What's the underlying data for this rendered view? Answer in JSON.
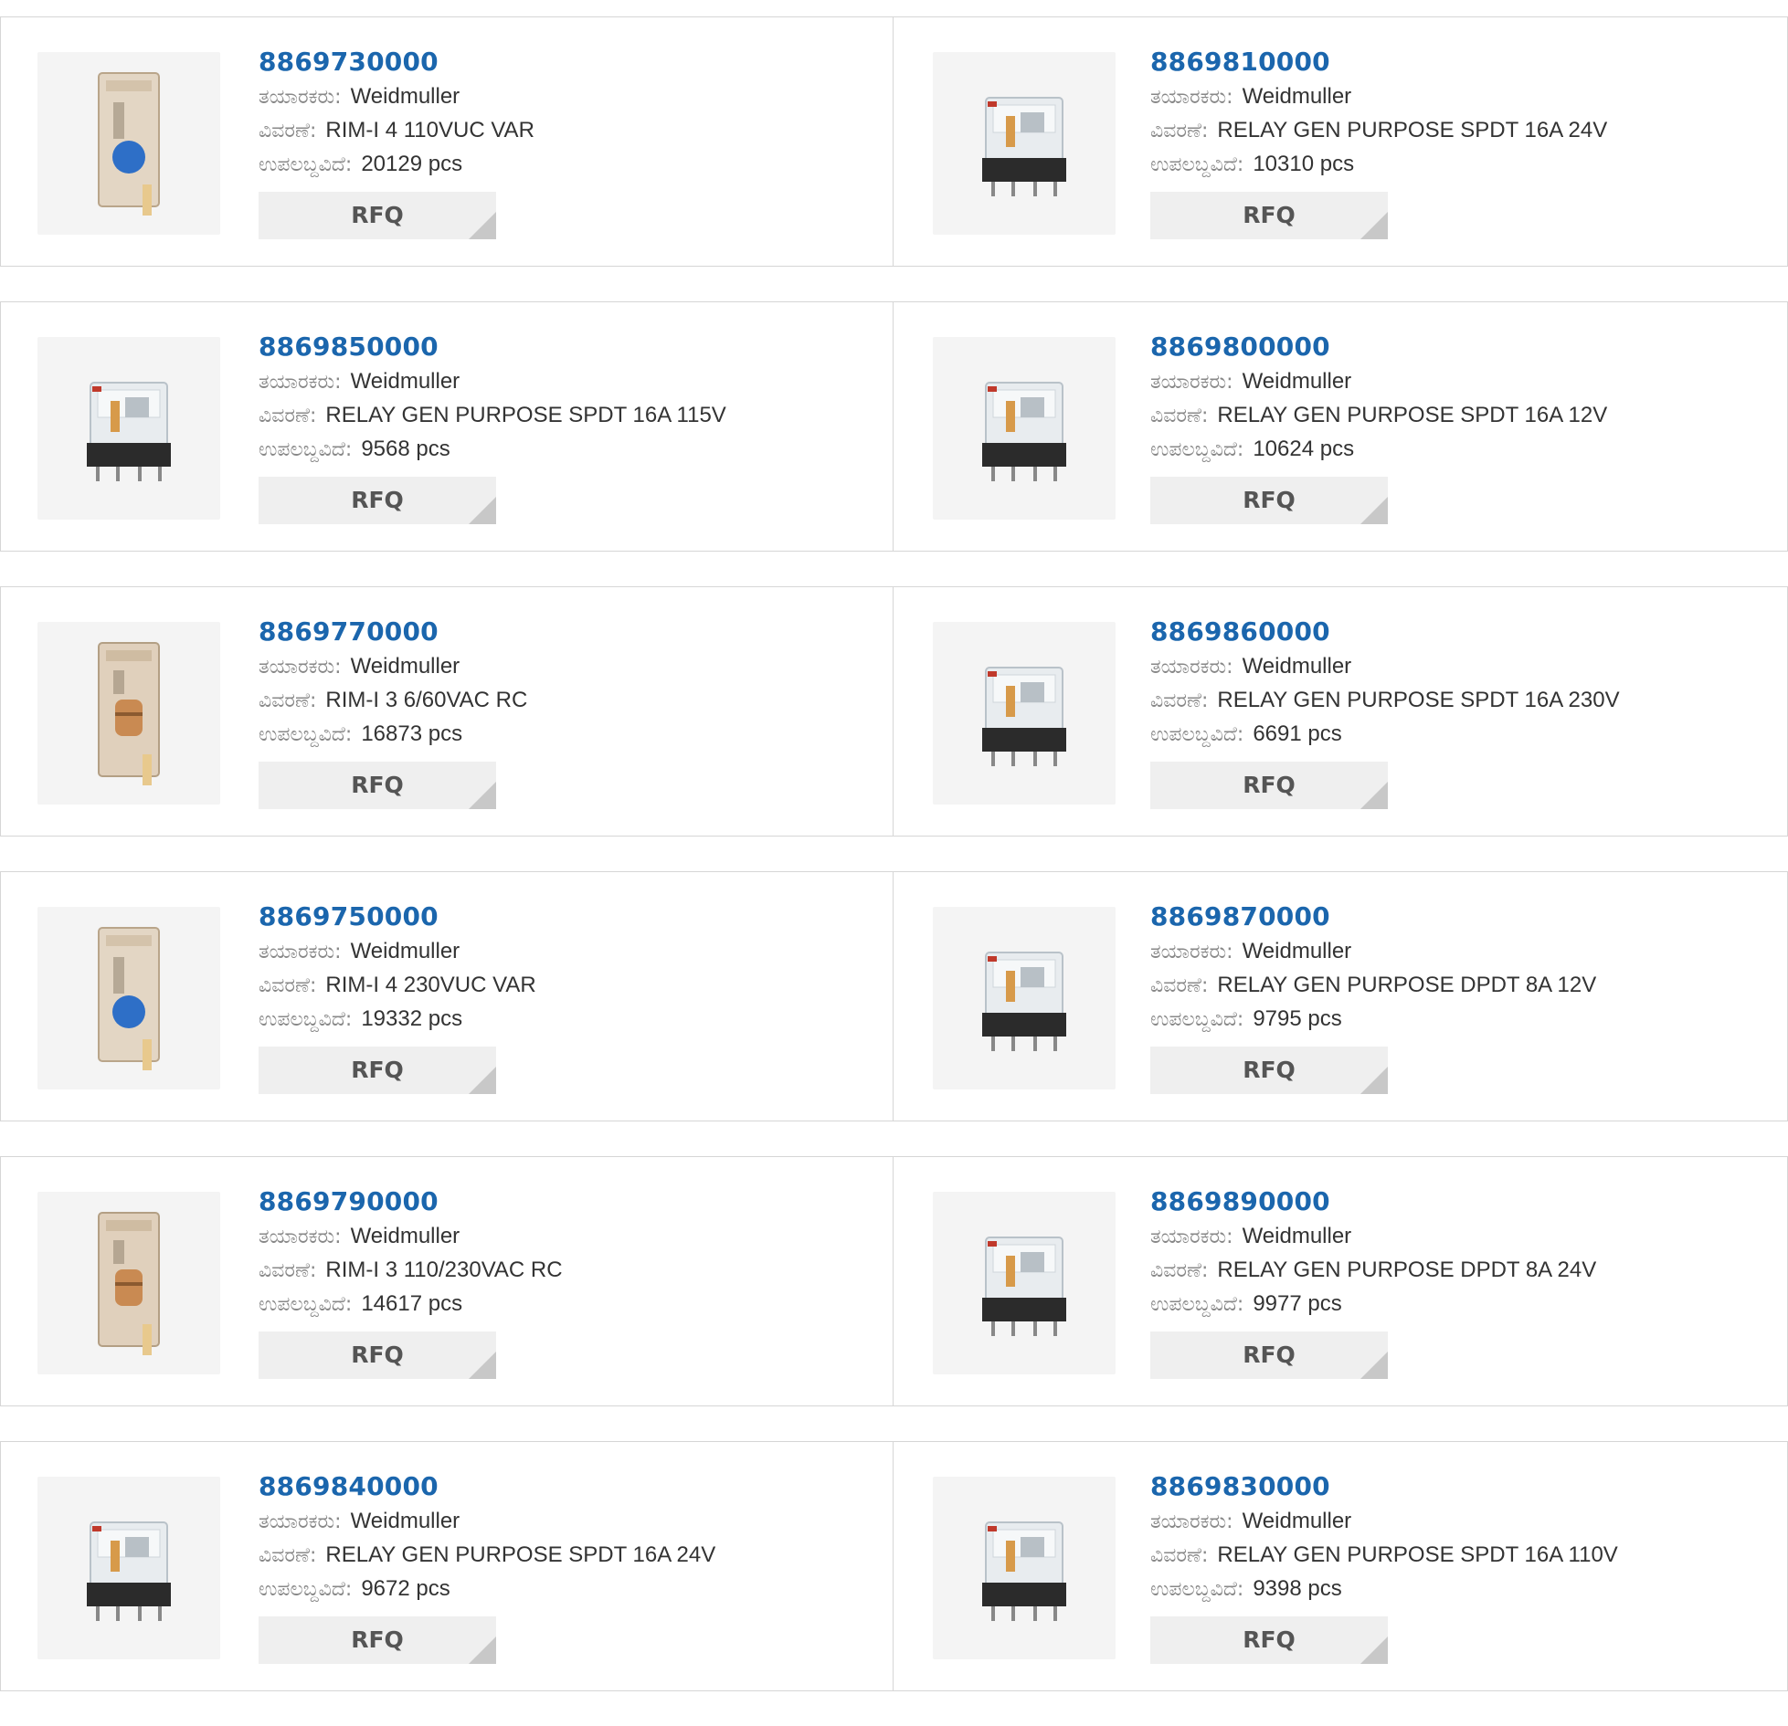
{
  "labels": {
    "manufacturer": "ತಯಾರಕರು:",
    "description": "ವಿವರಣೆ:",
    "available": "ಉಪಲಬ್ದವಿದೆ:",
    "rfq": "RFQ"
  },
  "colors": {
    "part_link": "#1b66ad",
    "button_bg": "#efefef",
    "border": "#d6d6d6"
  },
  "products": [
    {
      "part": "8869730000",
      "manufacturer": "Weidmuller",
      "description": "RIM-I 4 110VUC VAR",
      "stock": "20129 pcs",
      "image": "module-varistor"
    },
    {
      "part": "8869810000",
      "manufacturer": "Weidmuller",
      "description": "RELAY GEN PURPOSE SPDT 16A 24V",
      "stock": "10310 pcs",
      "image": "relay"
    },
    {
      "part": "8869850000",
      "manufacturer": "Weidmuller",
      "description": "RELAY GEN PURPOSE SPDT 16A 115V",
      "stock": "9568 pcs",
      "image": "relay"
    },
    {
      "part": "8869800000",
      "manufacturer": "Weidmuller",
      "description": "RELAY GEN PURPOSE SPDT 16A 12V",
      "stock": "10624 pcs",
      "image": "relay"
    },
    {
      "part": "8869770000",
      "manufacturer": "Weidmuller",
      "description": "RIM-I 3 6/60VAC RC",
      "stock": "16873 pcs",
      "image": "module-rc"
    },
    {
      "part": "8869860000",
      "manufacturer": "Weidmuller",
      "description": "RELAY GEN PURPOSE SPDT 16A 230V",
      "stock": "6691 pcs",
      "image": "relay"
    },
    {
      "part": "8869750000",
      "manufacturer": "Weidmuller",
      "description": "RIM-I 4 230VUC VAR",
      "stock": "19332 pcs",
      "image": "module-varistor"
    },
    {
      "part": "8869870000",
      "manufacturer": "Weidmuller",
      "description": "RELAY GEN PURPOSE DPDT 8A 12V",
      "stock": "9795 pcs",
      "image": "relay"
    },
    {
      "part": "8869790000",
      "manufacturer": "Weidmuller",
      "description": "RIM-I 3 110/230VAC RC",
      "stock": "14617 pcs",
      "image": "module-rc"
    },
    {
      "part": "8869890000",
      "manufacturer": "Weidmuller",
      "description": "RELAY GEN PURPOSE DPDT 8A 24V",
      "stock": "9977 pcs",
      "image": "relay"
    },
    {
      "part": "8869840000",
      "manufacturer": "Weidmuller",
      "description": "RELAY GEN PURPOSE SPDT 16A 24V",
      "stock": "9672 pcs",
      "image": "relay"
    },
    {
      "part": "8869830000",
      "manufacturer": "Weidmuller",
      "description": "RELAY GEN PURPOSE SPDT 16A 110V",
      "stock": "9398 pcs",
      "image": "relay"
    }
  ]
}
